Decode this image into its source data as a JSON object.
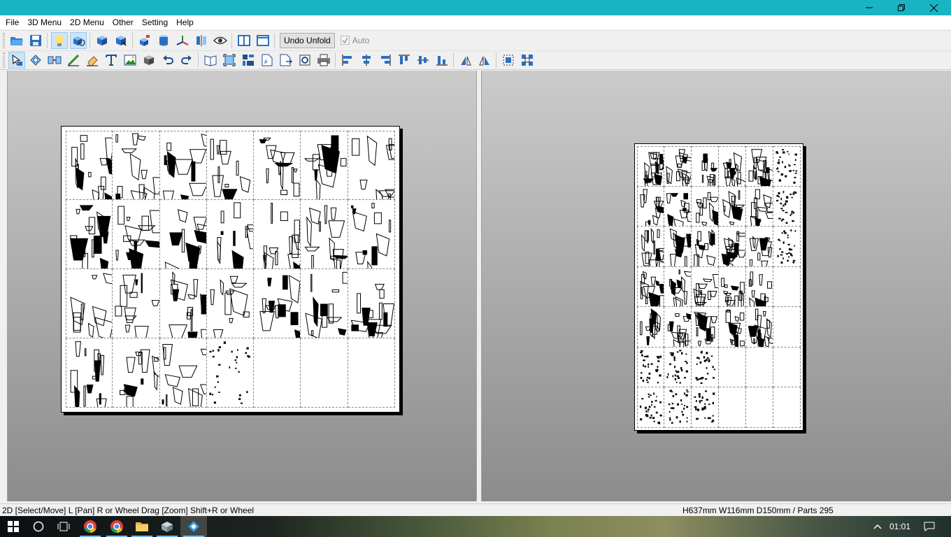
{
  "menu": [
    "File",
    "3D Menu",
    "2D Menu",
    "Other",
    "Setting",
    "Help"
  ],
  "toolbar": {
    "undo_unfold_label": "Undo Unfold",
    "auto_label": "Auto",
    "auto_checked": true
  },
  "status": {
    "left": "2D [Select/Move] L [Pan] R or Wheel Drag [Zoom] Shift+R or Wheel",
    "right": "H637mm W116mm D150mm / Parts 295"
  },
  "taskbar": {
    "clock": "01:01"
  },
  "colors": {
    "titlebar": "#18b4c4",
    "pane_top": "#cbcbcb",
    "pane_bottom": "#8c8c8c",
    "selection": "#cce4f7"
  },
  "icons": {
    "toolbar1": [
      "open-folder-icon",
      "save-icon",
      "light-bulb-icon",
      "3d-view-icon",
      "cube-blue-icon",
      "cube-blue-2-icon",
      "cube-paint-icon",
      "cylinder-icon",
      "axis-icon",
      "mirror-icon",
      "eye-icon",
      "split-view-icon",
      "single-view-icon"
    ],
    "toolbar2": [
      "select-move-icon",
      "rotate-part-icon",
      "join-icon",
      "draw-line-icon",
      "eraser-icon",
      "text-icon",
      "image-icon",
      "box-icon",
      "undo-icon",
      "redo-icon",
      "book-icon",
      "fit-icon",
      "layout-icon",
      "page-number-icon",
      "export-icon",
      "print-preview-icon",
      "print-icon",
      "align-left-icon",
      "align-center-icon",
      "align-right-icon",
      "align-top-icon",
      "align-middle-icon",
      "align-bottom-icon",
      "flip-left-icon",
      "flip-right-icon",
      "group-icon",
      "ungroup-icon"
    ]
  }
}
